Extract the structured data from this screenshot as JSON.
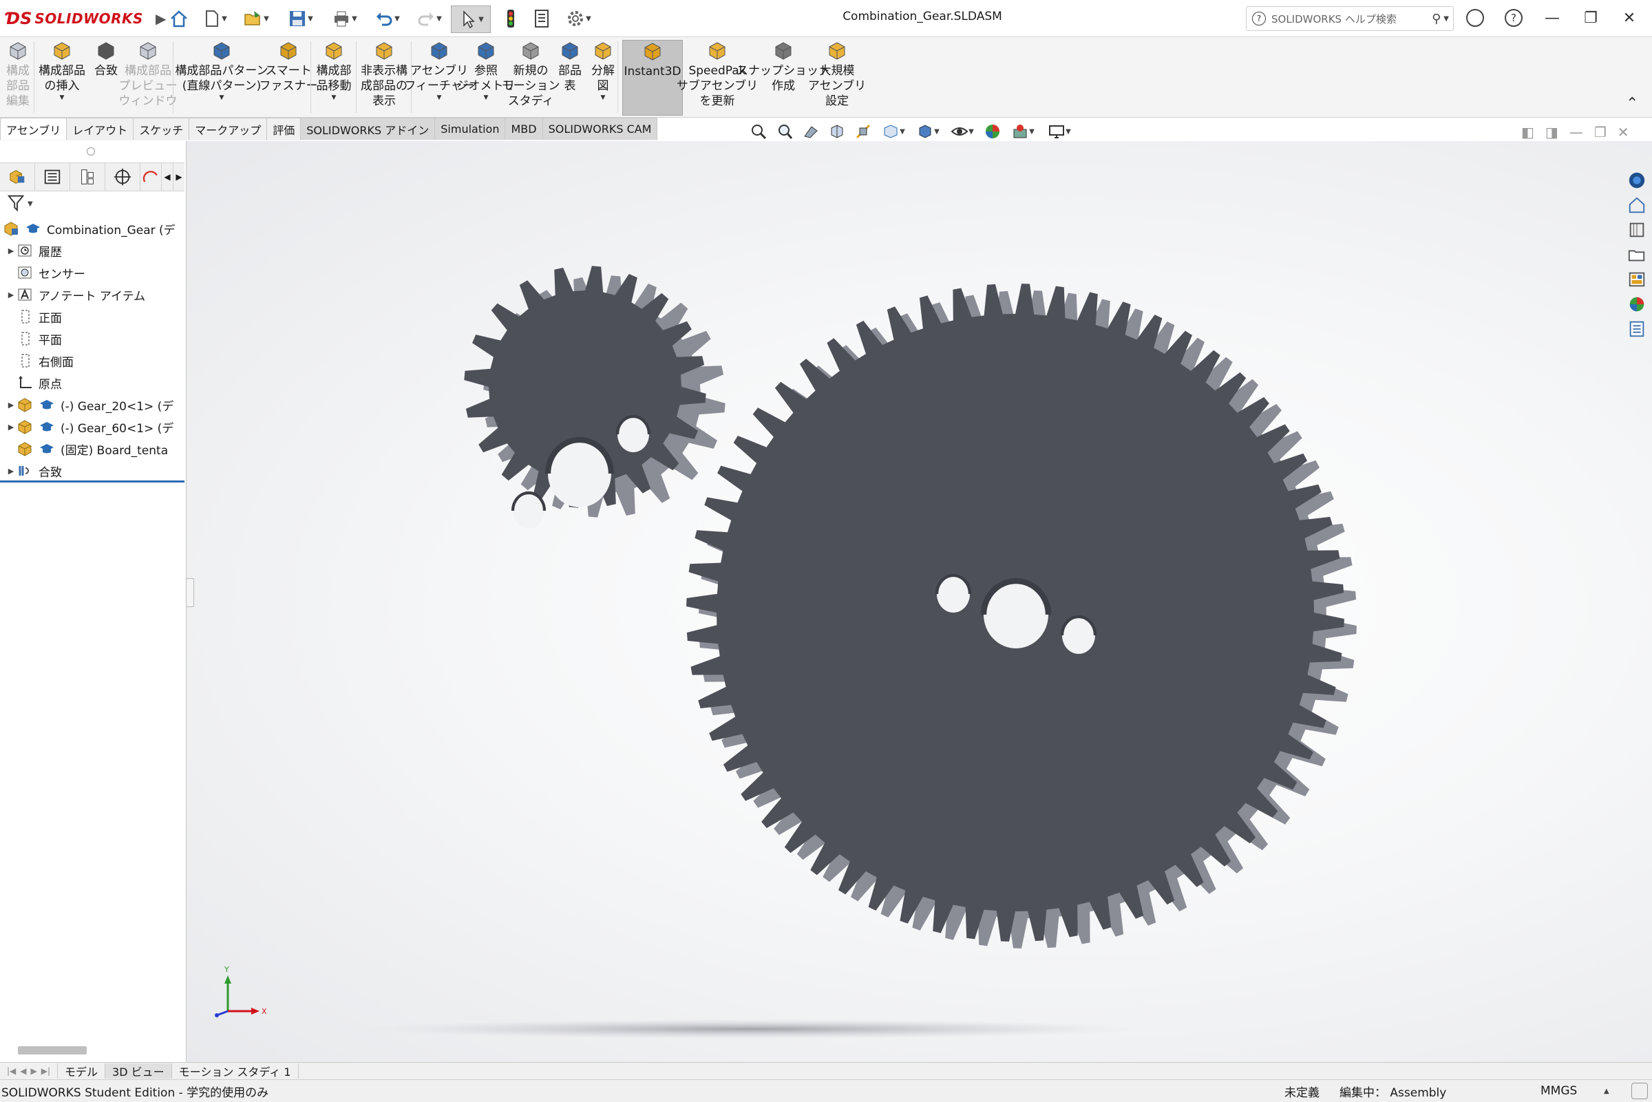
{
  "app": {
    "logo_brand": "SOLIDWORKS",
    "window_title": "Combination_Gear.SLDASM",
    "search_placeholder": "SOLIDWORKS ヘルプ検索",
    "accent_color": "#d0121b"
  },
  "quick_access": {
    "icons": [
      "home-icon",
      "new-document-icon",
      "open-icon",
      "save-icon",
      "print-icon",
      "undo-icon",
      "redo-icon",
      "select-icon",
      "rebuild-icon",
      "file-properties-icon",
      "options-icon"
    ]
  },
  "ribbon": {
    "buttons": [
      {
        "label": "構成\n部品\n編集",
        "disabled": true
      },
      {
        "label": "構成部品\nの挿入"
      },
      {
        "label": "合致"
      },
      {
        "label": "構成部品\nプレビュー\nウィンドウ",
        "disabled": true
      },
      {
        "label": "構成部品パターン\n(直線パターン)"
      },
      {
        "label": "スマート\nファスナー"
      },
      {
        "label": "構成部\n品移動"
      },
      {
        "label": "非表示構\n成部品の\n表示"
      },
      {
        "label": "アセンブリ\nフィーチャー"
      },
      {
        "label": "参照\nジオメトリ"
      },
      {
        "label": "新規の\nモーション\nスタディ"
      },
      {
        "label": "部品\n表"
      },
      {
        "label": "分解\n図"
      },
      {
        "label": "Instant3D",
        "active": true
      },
      {
        "label": "SpeedPak\nサブアセンブリ\nを更新"
      },
      {
        "label": "スナップショット\n作成"
      },
      {
        "label": "大規模\nアセンブリ\n設定"
      }
    ]
  },
  "command_tabs": [
    "アセンブリ",
    "レイアウト",
    "スケッチ",
    "マークアップ",
    "評価",
    "SOLIDWORKS アドイン",
    "Simulation",
    "MBD",
    "SOLIDWORKS CAM"
  ],
  "feature_tree": {
    "items": [
      {
        "label": "Combination_Gear  (デ",
        "icon": "assembly-icon",
        "expandable": false
      },
      {
        "label": "履歴",
        "icon": "history-icon",
        "expandable": true
      },
      {
        "label": "センサー",
        "icon": "sensor-icon",
        "expandable": false
      },
      {
        "label": "アノテート アイテム",
        "icon": "annotation-icon",
        "expandable": true
      },
      {
        "label": "正面",
        "icon": "plane-icon",
        "expandable": false
      },
      {
        "label": "平面",
        "icon": "plane-icon",
        "expandable": false
      },
      {
        "label": "右側面",
        "icon": "plane-icon",
        "expandable": false
      },
      {
        "label": "原点",
        "icon": "origin-icon",
        "expandable": false
      },
      {
        "label": "(-) Gear_20<1> (デ",
        "icon": "part-icon",
        "expandable": true
      },
      {
        "label": "(-) Gear_60<1> (デ",
        "icon": "part-icon",
        "expandable": true
      },
      {
        "label": "(固定) Board_tenta",
        "icon": "part-icon",
        "expandable": false
      },
      {
        "label": "合致",
        "icon": "mate-icon",
        "expandable": true
      }
    ]
  },
  "viewport": {
    "gear_color": "#4e5058",
    "gear_side_color": "#8a8c96",
    "small_gear_teeth": 20,
    "large_gear_teeth": 60,
    "triad": {
      "x_label": "X",
      "y_label": "Y"
    }
  },
  "bottom_tabs": [
    "モデル",
    "3D ビュー",
    "モーション スタディ 1"
  ],
  "status": {
    "edition": "SOLIDWORKS Student Edition - 学究的使用のみ",
    "definition": "未定義",
    "editing": "編集中： Assembly",
    "units": "MMGS"
  }
}
